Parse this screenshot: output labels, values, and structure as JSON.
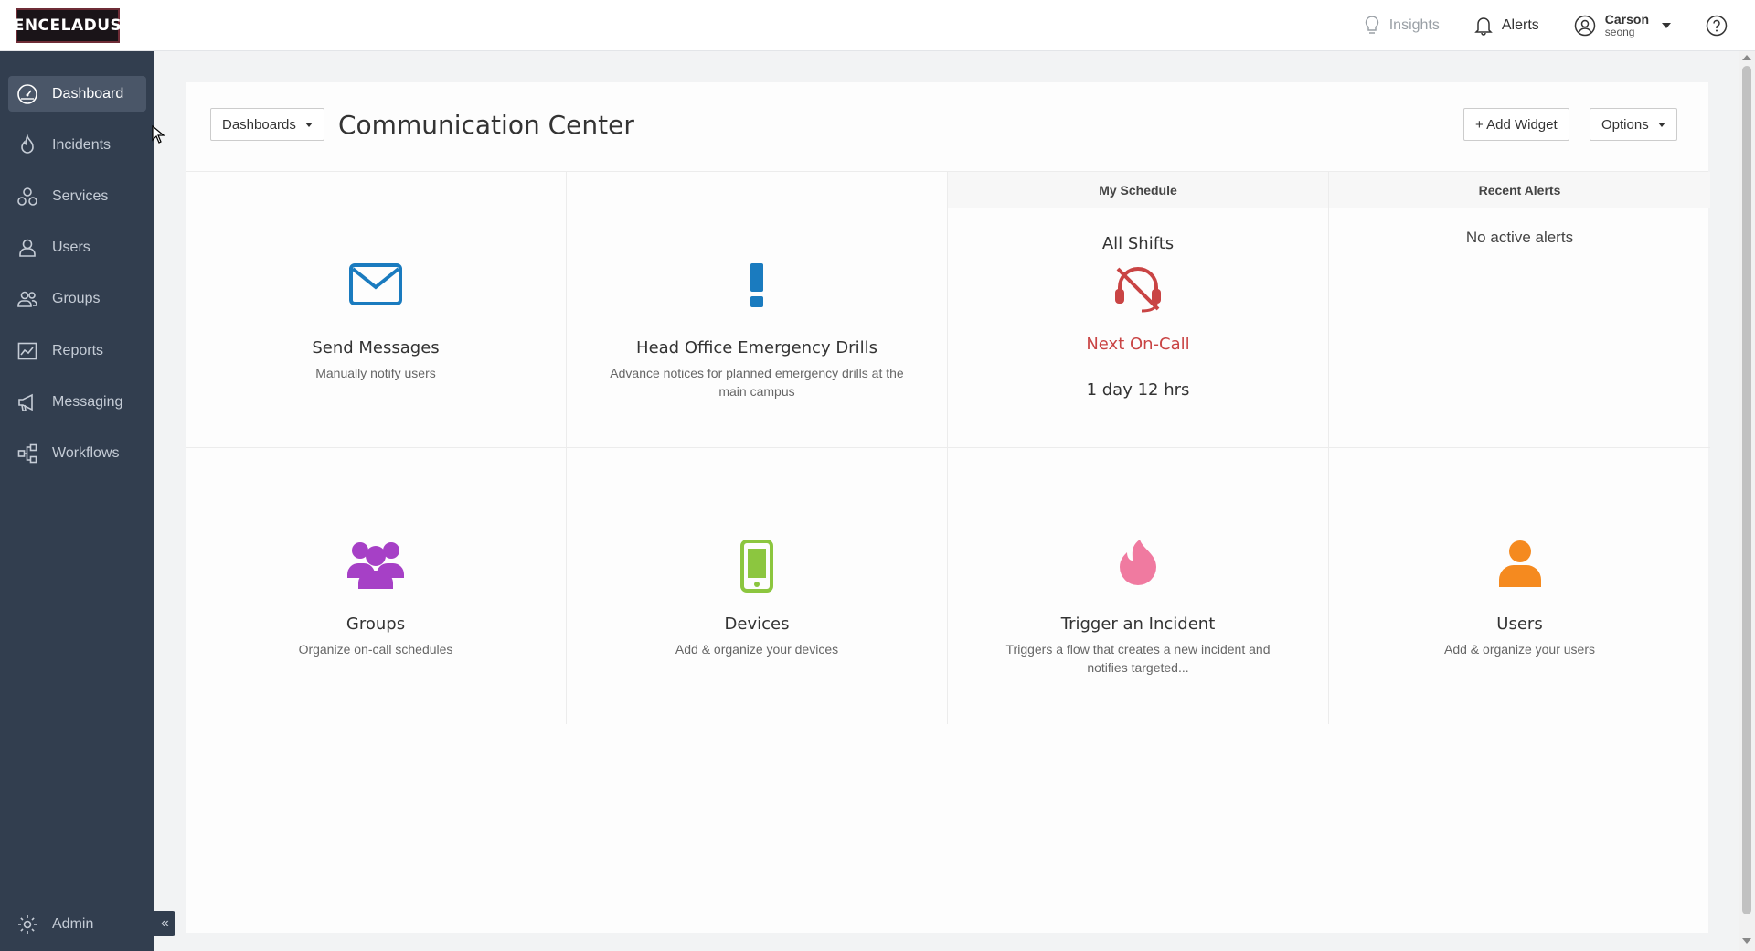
{
  "brand": {
    "logo_text": "ENCELADUS"
  },
  "topbar": {
    "insights_label": "Insights",
    "alerts_label": "Alerts",
    "user_name": "Carson",
    "user_sub": "seong",
    "help_icon": "question-circle-icon"
  },
  "sidebar": {
    "items": [
      {
        "label": "Dashboard",
        "icon": "speedometer-icon"
      },
      {
        "label": "Incidents",
        "icon": "flame-icon"
      },
      {
        "label": "Services",
        "icon": "services-icon"
      },
      {
        "label": "Users",
        "icon": "user-icon"
      },
      {
        "label": "Groups",
        "icon": "users-group-icon"
      },
      {
        "label": "Reports",
        "icon": "chart-icon"
      },
      {
        "label": "Messaging",
        "icon": "megaphone-icon"
      },
      {
        "label": "Workflows",
        "icon": "workflow-icon"
      }
    ],
    "admin_label": "Admin",
    "collapse_label": "«"
  },
  "header": {
    "dashboards_label": "Dashboards",
    "title": "Communication Center",
    "add_widget_label": "+ Add Widget",
    "options_label": "Options"
  },
  "widgets": {
    "send_messages": {
      "title": "Send Messages",
      "desc": "Manually notify users"
    },
    "drills": {
      "title": "Head Office Emergency Drills",
      "desc": "Advance notices for planned emergency drills at the main campus"
    },
    "schedule": {
      "heading": "My Schedule",
      "shifts": "All Shifts",
      "next_oncall": "Next On-Call",
      "time_until": "1 day 12 hrs"
    },
    "recent_alerts": {
      "heading": "Recent Alerts",
      "empty": "No active alerts"
    },
    "groups": {
      "title": "Groups",
      "desc": "Organize on-call schedules"
    },
    "devices": {
      "title": "Devices",
      "desc": "Add & organize your devices"
    },
    "trigger": {
      "title": "Trigger an Incident",
      "desc": "Triggers a flow that creates a new incident and notifies targeted..."
    },
    "users": {
      "title": "Users",
      "desc": "Add & organize your users"
    }
  },
  "colors": {
    "sidebar_bg": "#323e4f",
    "mail_blue": "#1a7bbf",
    "alert_blue": "#1a7bbf",
    "schedule_red": "#c94444",
    "groups_purple": "#a640c6",
    "devices_green": "#8cc63f",
    "incident_pink": "#f07aa0",
    "users_orange": "#f58a1f"
  }
}
